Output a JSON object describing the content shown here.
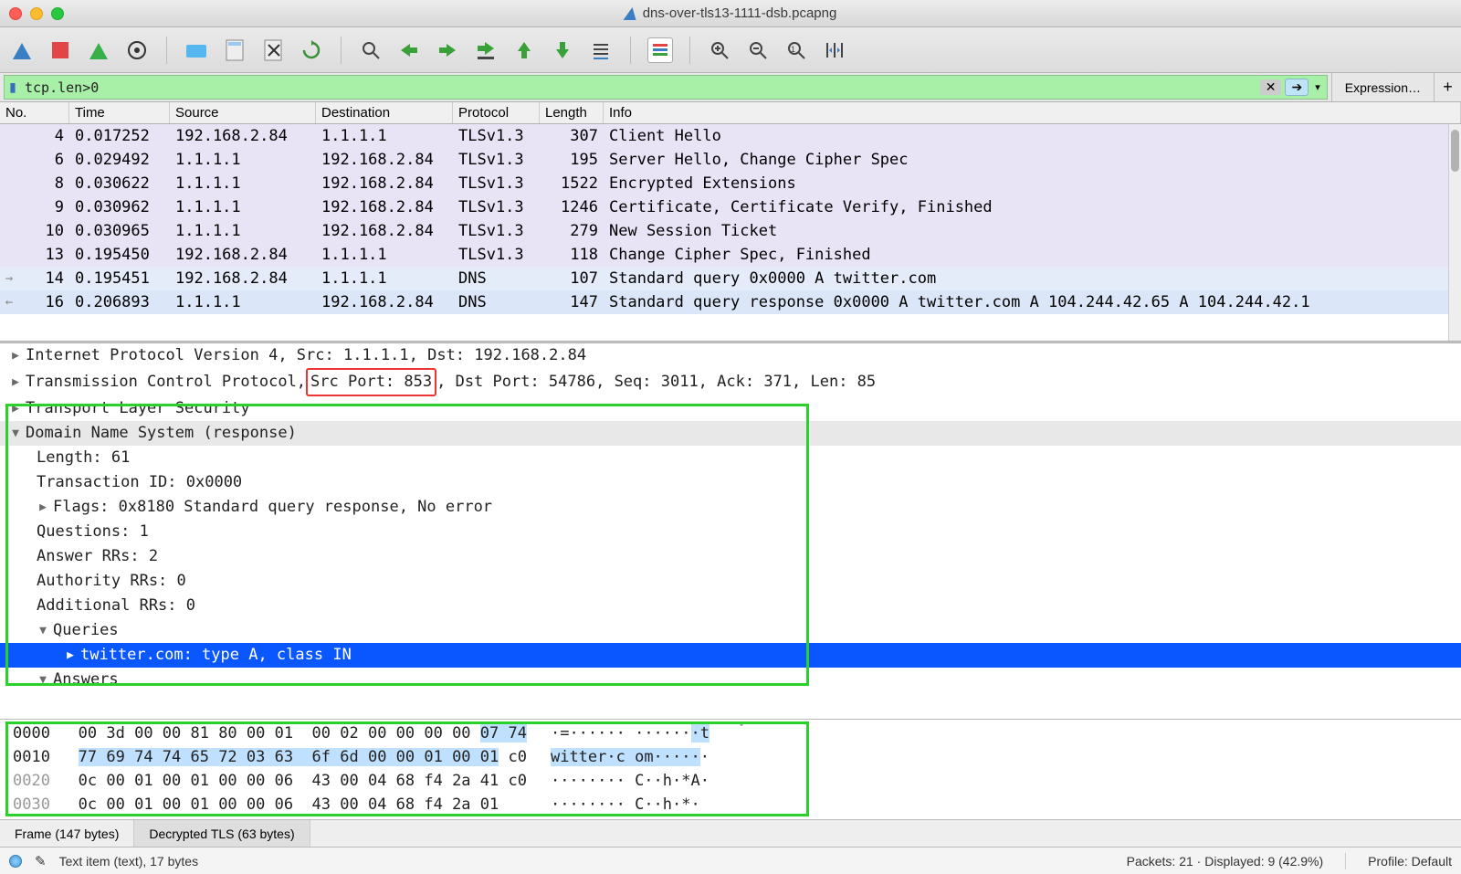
{
  "window": {
    "title": "dns-over-tls13-1111-dsb.pcapng"
  },
  "filter": {
    "value": "tcp.len>0",
    "expression_label": "Expression…"
  },
  "columns": {
    "no": "No.",
    "time": "Time",
    "source": "Source",
    "destination": "Destination",
    "protocol": "Protocol",
    "length": "Length",
    "info": "Info"
  },
  "packets": [
    {
      "no": "4",
      "time": "0.017252",
      "src": "192.168.2.84",
      "dst": "1.1.1.1",
      "proto": "TLSv1.3",
      "len": "307",
      "info": "Client Hello",
      "cls": "tls",
      "g": ""
    },
    {
      "no": "6",
      "time": "0.029492",
      "src": "1.1.1.1",
      "dst": "192.168.2.84",
      "proto": "TLSv1.3",
      "len": "195",
      "info": "Server Hello, Change Cipher Spec",
      "cls": "tls",
      "g": ""
    },
    {
      "no": "8",
      "time": "0.030622",
      "src": "1.1.1.1",
      "dst": "192.168.2.84",
      "proto": "TLSv1.3",
      "len": "1522",
      "info": "Encrypted Extensions",
      "cls": "tls",
      "g": ""
    },
    {
      "no": "9",
      "time": "0.030962",
      "src": "1.1.1.1",
      "dst": "192.168.2.84",
      "proto": "TLSv1.3",
      "len": "1246",
      "info": "Certificate, Certificate Verify, Finished",
      "cls": "tls",
      "g": ""
    },
    {
      "no": "10",
      "time": "0.030965",
      "src": "1.1.1.1",
      "dst": "192.168.2.84",
      "proto": "TLSv1.3",
      "len": "279",
      "info": "New Session Ticket",
      "cls": "tls",
      "g": ""
    },
    {
      "no": "13",
      "time": "0.195450",
      "src": "192.168.2.84",
      "dst": "1.1.1.1",
      "proto": "TLSv1.3",
      "len": "118",
      "info": "Change Cipher Spec, Finished",
      "cls": "tls",
      "g": ""
    },
    {
      "no": "14",
      "time": "0.195451",
      "src": "192.168.2.84",
      "dst": "1.1.1.1",
      "proto": "DNS",
      "len": "107",
      "info": "Standard query 0x0000 A twitter.com",
      "cls": "dns1",
      "g": "→"
    },
    {
      "no": "16",
      "time": "0.206893",
      "src": "1.1.1.1",
      "dst": "192.168.2.84",
      "proto": "DNS",
      "len": "147",
      "info": "Standard query response 0x0000 A twitter.com A 104.244.42.65 A 104.244.42.1",
      "cls": "dns2",
      "g": "←"
    }
  ],
  "details": {
    "ip": "Internet Protocol Version 4, Src: 1.1.1.1, Dst: 192.168.2.84",
    "tcp_pre": "Transmission Control Protocol, ",
    "tcp_red": "Src Port: 853",
    "tcp_post": ", Dst Port: 54786, Seq: 3011, Ack: 371, Len: 85",
    "tls": "Transport Layer Security",
    "dns": "Domain Name System (response)",
    "len": "Length: 61",
    "txid": "Transaction ID: 0x0000",
    "flags": "Flags: 0x8180 Standard query response, No error",
    "q": "Questions: 1",
    "arr": "Answer RRs: 2",
    "auth": "Authority RRs: 0",
    "addl": "Additional RRs: 0",
    "queries": "Queries",
    "query0": "twitter.com: type A, class IN",
    "answers": "Answers"
  },
  "hex": {
    "l0_off": "0000",
    "l0_a": "00 3d 00 00 81 80 00 01  00 02 00 00 00 00 ",
    "l0_hl": "07 74",
    "l0_asc": "·=······ ······",
    "l0_asc_hl": "·t",
    "l1_off": "0010",
    "l1_hl": "77 69 74 74 65 72 03 63  6f 6d 00 00 01 00 01",
    "l1_b": " c0",
    "l1_asc_hl": "witter·c om·····",
    "l1_asc_b": "·",
    "l2_off": "0020",
    "l2": "0c 00 01 00 01 00 00 06  43 00 04 68 f4 2a 41 c0",
    "l2_asc": "········ C··h·*A·",
    "l3_off": "0030",
    "l3": "0c 00 01 00 01 00 00 06  43 00 04 68 f4 2a 01",
    "l3_asc": "········ C··h·*·"
  },
  "tabs": {
    "frame": "Frame (147 bytes)",
    "decrypted": "Decrypted TLS (63 bytes)"
  },
  "status": {
    "text_item": "Text item (text), 17 bytes",
    "packets": "Packets: 21 · Displayed: 9 (42.9%)",
    "profile": "Profile: Default"
  }
}
